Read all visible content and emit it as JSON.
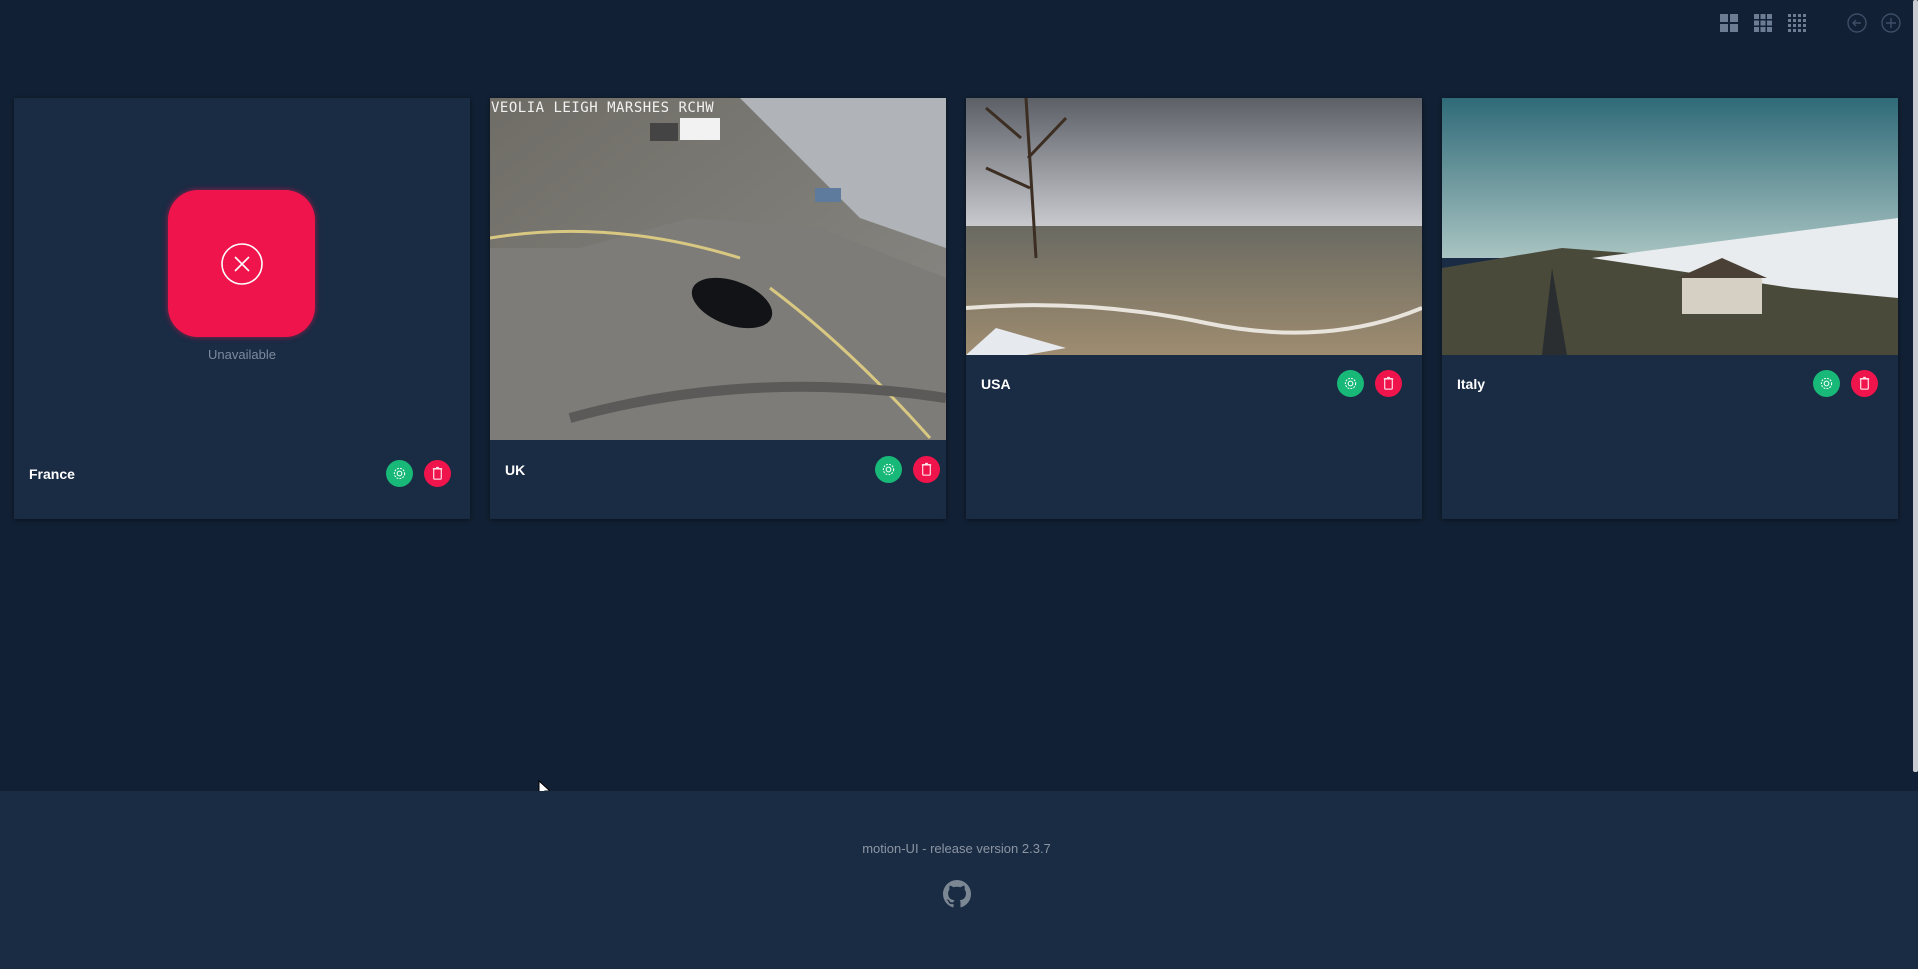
{
  "toolbar": {
    "icons": [
      "grid-large-icon",
      "grid-medium-icon",
      "grid-small-icon",
      "back-icon",
      "add-icon"
    ]
  },
  "cameras": [
    {
      "name": "France",
      "status": "Unavailable",
      "has_image": false
    },
    {
      "name": "UK",
      "overlay": "VEOLIA LEIGH MARSHES RCHW",
      "has_image": true
    },
    {
      "name": "USA",
      "has_image": true
    },
    {
      "name": "Italy",
      "has_image": true
    }
  ],
  "footer": {
    "version_text": "motion-UI - release version 2.3.7",
    "icon": "github-icon"
  },
  "colors": {
    "background": "#112034",
    "card": "#1a2b44",
    "green": "#18b878",
    "red": "#f0144c"
  }
}
